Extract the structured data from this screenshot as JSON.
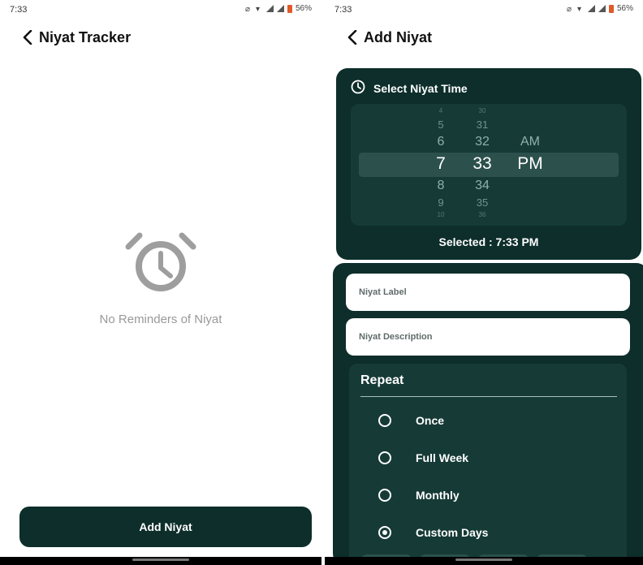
{
  "left_screen": {
    "status": {
      "time": "7:33",
      "battery": "56%"
    },
    "header": {
      "title": "Niyat Tracker"
    },
    "empty_state": {
      "message": "No Reminders of Niyat"
    },
    "add_button_label": "Add Niyat"
  },
  "right_screen": {
    "status": {
      "time": "7:33",
      "battery": "56%"
    },
    "header": {
      "title": "Add Niyat"
    },
    "time_picker": {
      "heading": "Select Niyat Time",
      "hours": [
        "4",
        "5",
        "6",
        "7",
        "8",
        "9",
        "10"
      ],
      "minutes": [
        "30",
        "31",
        "32",
        "33",
        "34",
        "35",
        "36"
      ],
      "periods": [
        "AM",
        "PM"
      ],
      "selected_hour": "7",
      "selected_minute": "33",
      "selected_period": "PM",
      "selected_text": "Selected : 7:33 PM"
    },
    "form": {
      "label_placeholder": "Niyat Label",
      "description_placeholder": "Niyat Description"
    },
    "repeat": {
      "title": "Repeat",
      "options": [
        {
          "label": "Once",
          "selected": false
        },
        {
          "label": "Full Week",
          "selected": false
        },
        {
          "label": "Monthly",
          "selected": false
        },
        {
          "label": "Custom Days",
          "selected": true
        }
      ]
    }
  },
  "colors": {
    "primary": "#0d2e2b",
    "panel": "#163b37",
    "highlight": "#2c514c",
    "muted_text": "#999999"
  }
}
